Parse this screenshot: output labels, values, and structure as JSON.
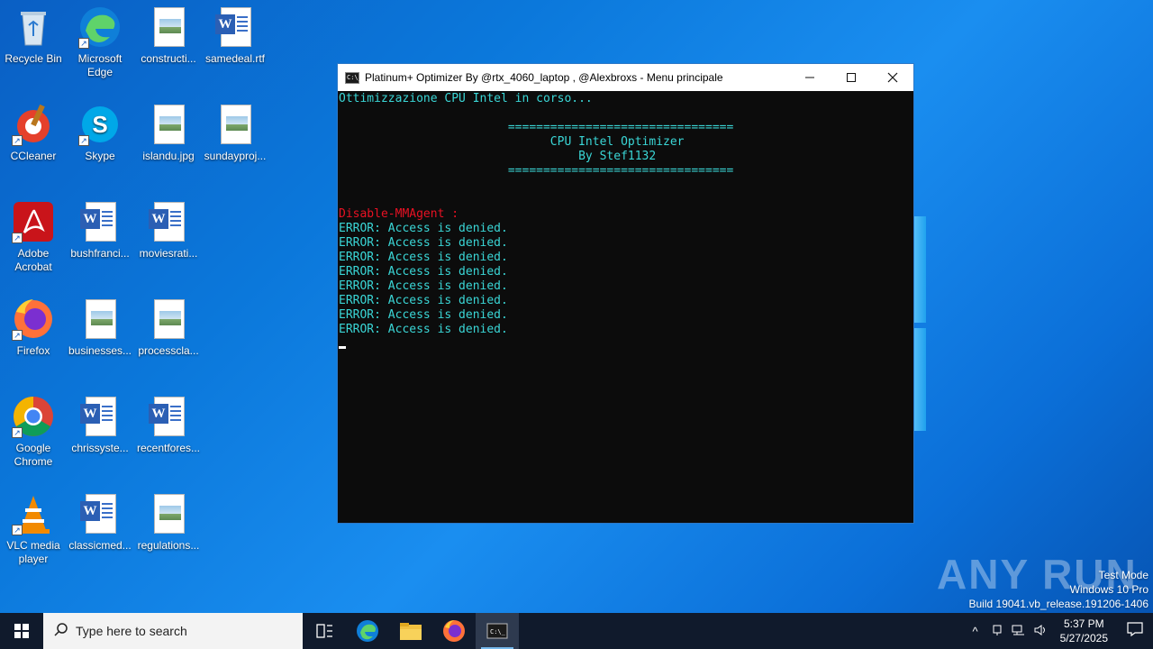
{
  "desktop": {
    "icons": [
      {
        "label": "Recycle Bin",
        "icon": "recycle-bin-icon"
      },
      {
        "label": "Microsoft Edge",
        "icon": "edge-icon"
      },
      {
        "label": "constructi...",
        "icon": "image-file-icon"
      },
      {
        "label": "samedeal.rtf",
        "icon": "word-doc-icon"
      },
      {
        "label": "CCleaner",
        "icon": "ccleaner-icon"
      },
      {
        "label": "Skype",
        "icon": "skype-icon"
      },
      {
        "label": "islandu.jpg",
        "icon": "image-file-icon"
      },
      {
        "label": "sundayproj...",
        "icon": "image-file-icon"
      },
      {
        "label": "Adobe Acrobat",
        "icon": "acrobat-icon"
      },
      {
        "label": "bushfranci...",
        "icon": "word-doc-icon"
      },
      {
        "label": "moviesrati...",
        "icon": "word-doc-icon"
      },
      {
        "label": "Firefox",
        "icon": "firefox-icon"
      },
      {
        "label": "businesses...",
        "icon": "image-file-icon"
      },
      {
        "label": "processcla...",
        "icon": "image-file-icon"
      },
      {
        "label": "Google Chrome",
        "icon": "chrome-icon"
      },
      {
        "label": "chrissyste...",
        "icon": "word-doc-icon"
      },
      {
        "label": "recentfores...",
        "icon": "word-doc-icon"
      },
      {
        "label": "VLC media player",
        "icon": "vlc-icon"
      },
      {
        "label": "classicmed...",
        "icon": "word-doc-icon"
      },
      {
        "label": "regulations...",
        "icon": "image-file-icon"
      }
    ]
  },
  "console": {
    "title": "Platinum+ Optimizer By @rtx_4060_laptop , @Alexbroxs - Menu principale",
    "icon_text": "C:\\_",
    "minimize": "—",
    "maximize": "☐",
    "close": "✕",
    "lines": [
      {
        "text": "Ottimizzazione CPU Intel in corso...",
        "color": "cyan"
      },
      {
        "text": "",
        "color": "cyan"
      },
      {
        "text": "                        ================================",
        "color": "cyan"
      },
      {
        "text": "                              CPU Intel Optimizer",
        "color": "cyan"
      },
      {
        "text": "                                  By Stef1132",
        "color": "cyan"
      },
      {
        "text": "                        ================================",
        "color": "cyan"
      },
      {
        "text": "",
        "color": "cyan"
      },
      {
        "text": "",
        "color": "cyan"
      },
      {
        "text": "Disable-MMAgent :",
        "color": "red"
      },
      {
        "text": "ERROR: Access is denied.",
        "color": "cyan"
      },
      {
        "text": "ERROR: Access is denied.",
        "color": "cyan"
      },
      {
        "text": "ERROR: Access is denied.",
        "color": "cyan"
      },
      {
        "text": "ERROR: Access is denied.",
        "color": "cyan"
      },
      {
        "text": "ERROR: Access is denied.",
        "color": "cyan"
      },
      {
        "text": "ERROR: Access is denied.",
        "color": "cyan"
      },
      {
        "text": "ERROR: Access is denied.",
        "color": "cyan"
      },
      {
        "text": "ERROR: Access is denied.",
        "color": "cyan"
      }
    ]
  },
  "watermark": {
    "brand": "ANY RUN",
    "line1": "Test Mode",
    "line2": "Windows 10 Pro",
    "line3": "Build 19041.vb_release.191206-1406"
  },
  "taskbar": {
    "search_placeholder": "Type here to search",
    "apps": [
      "task-view-icon",
      "edge-icon",
      "file-explorer-icon",
      "firefox-icon",
      "cmd-icon"
    ],
    "tray": {
      "chevron": "^",
      "time": "5:37 PM",
      "date": "5/27/2025"
    }
  },
  "colors": {
    "console_text": "#3ad6d6",
    "console_red": "#e81123",
    "accent": "#0b78db"
  }
}
